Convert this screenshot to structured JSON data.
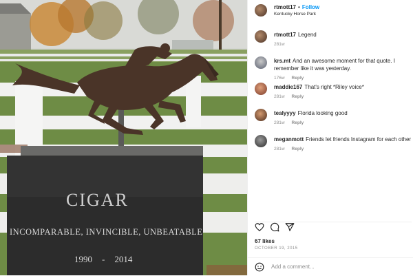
{
  "photo": {
    "plaque_name": "CIGAR",
    "plaque_subtitle": "INCOMPARABLE, INVINCIBLE, UNBEATABLE",
    "year_start": "1990",
    "year_end": "2014",
    "year_separator": "-"
  },
  "header": {
    "username": "rtmott17",
    "separator": "•",
    "follow_label": "Follow",
    "location": "Kentucky Horse Park"
  },
  "comments": [
    {
      "user": "rtmott17",
      "text": "Legend",
      "time": "281w",
      "reply": ""
    },
    {
      "user": "krs.mt",
      "text": "And an awesome moment for that quote. I remember like it was yesterday.",
      "time": "176w",
      "reply": "Reply"
    },
    {
      "user": "maddie167",
      "text": "That's right *Riley voice*",
      "time": "281w",
      "reply": "Reply"
    },
    {
      "user": "tealyyyy",
      "text": "Florida looking good",
      "time": "281w",
      "reply": "Reply"
    },
    {
      "user": "meganmott",
      "text": "Friends let friends Instagram for each other",
      "time": "281w",
      "reply": "Reply"
    }
  ],
  "likes": "67 likes",
  "date": "OCTOBER 19, 2015",
  "add_comment_placeholder": "Add a comment...",
  "icons": [
    "heart-icon",
    "comment-icon",
    "share-icon",
    "emoji-icon"
  ],
  "colors": {
    "follow": "#0095f6",
    "muted": "#8e8e8e",
    "text": "#262626"
  }
}
